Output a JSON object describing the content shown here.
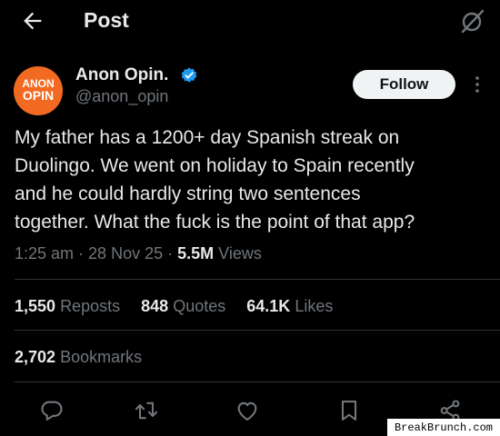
{
  "header": {
    "title": "Post"
  },
  "author": {
    "display_name": "Anon Opin.",
    "handle": "@anon_opin",
    "avatar_text_line1": "ANON",
    "avatar_text_line2": "OPIN",
    "verified": true
  },
  "follow_label": "Follow",
  "tweet": {
    "text": "My father has a 1200+ day Spanish streak on\nDuolingo. We went on holiday to Spain recently\nand he could hardly string two sentences\ntogether. What the fuck is the point of that app?",
    "time": "1:25 am",
    "date": "28 Nov 25",
    "views_count": "5.5M",
    "views_label": "Views"
  },
  "stats": {
    "reposts_count": "1,550",
    "reposts_label": "Reposts",
    "quotes_count": "848",
    "quotes_label": "Quotes",
    "likes_count": "64.1K",
    "likes_label": "Likes",
    "bookmarks_count": "2,702",
    "bookmarks_label": "Bookmarks"
  },
  "actions": [
    "reply-icon",
    "repost-icon",
    "like-icon",
    "bookmark-icon",
    "share-icon"
  ],
  "watermark": "BreakBrunch.com",
  "colors": {
    "background": "#000000",
    "text": "#e7e9ea",
    "secondary": "#71767b",
    "verified": "#1d9bf0",
    "avatar": "#f26a21",
    "divider": "#2f3336"
  }
}
